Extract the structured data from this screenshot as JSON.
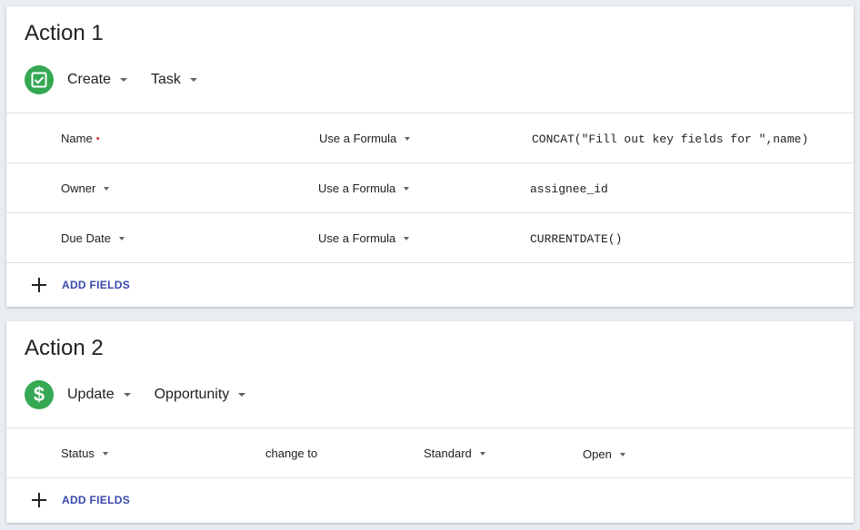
{
  "actions": [
    {
      "title": "Action 1",
      "verb": "Create",
      "object": "Task",
      "icon": "checkbox-check-icon",
      "rows": [
        {
          "field": "Name",
          "required": true,
          "mode": "Use a Formula",
          "value": "CONCAT(\"Fill out key fields for \",name)"
        },
        {
          "field": "Owner",
          "required": false,
          "mode": "Use a Formula",
          "value": "assignee_id"
        },
        {
          "field": "Due Date",
          "required": false,
          "mode": "Use a Formula",
          "value": "CURRENTDATE()"
        }
      ],
      "add_fields_label": "ADD FIELDS"
    },
    {
      "title": "Action 2",
      "verb": "Update",
      "object": "Opportunity",
      "icon": "dollar-icon",
      "rows": [
        {
          "field": "Status",
          "operator": "change to",
          "mode": "Standard",
          "value": "Open"
        }
      ],
      "add_fields_label": "ADD FIELDS"
    }
  ],
  "required_marker": "•",
  "colors": {
    "accent_green": "#34a853",
    "link_blue": "#3949ab",
    "required_red": "#d93025"
  }
}
